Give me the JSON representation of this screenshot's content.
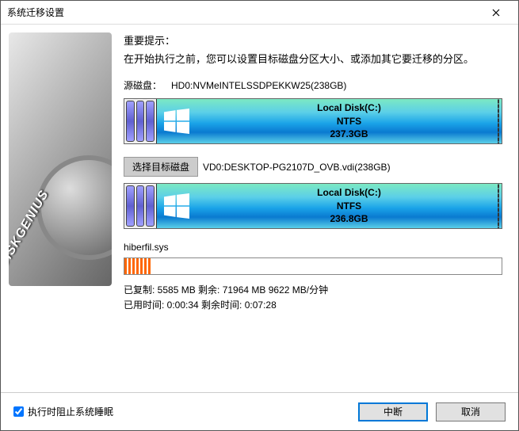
{
  "window": {
    "title": "系统迁移设置"
  },
  "hint": {
    "title": "重要提示：",
    "text": "在开始执行之前，您可以设置目标磁盘分区大小、或添加其它要迁移的分区。"
  },
  "source": {
    "label": "源磁盘：",
    "value": "HD0:NVMeINTELSSDPEKKW25(238GB)",
    "part_name": "Local Disk(C:)",
    "part_fs": "NTFS",
    "part_size": "237.3GB"
  },
  "target": {
    "select_label": "选择目标磁盘",
    "value": "VD0:DESKTOP-PG2107D_OVB.vdi(238GB)",
    "part_name": "Local Disk(C:)",
    "part_fs": "NTFS",
    "part_size": "236.8GB"
  },
  "progress": {
    "filename": "hiberfil.sys",
    "line1": "已复制:  5585 MB  剩余:  71964 MB  9622 MB/分钟",
    "line2": "已用时间:  0:00:34  剩余时间:  0:07:28"
  },
  "footer": {
    "checkbox_label": "执行时阻止系统睡眠",
    "abort": "中断",
    "cancel": "取消"
  },
  "brand": "DISKGENIUS"
}
